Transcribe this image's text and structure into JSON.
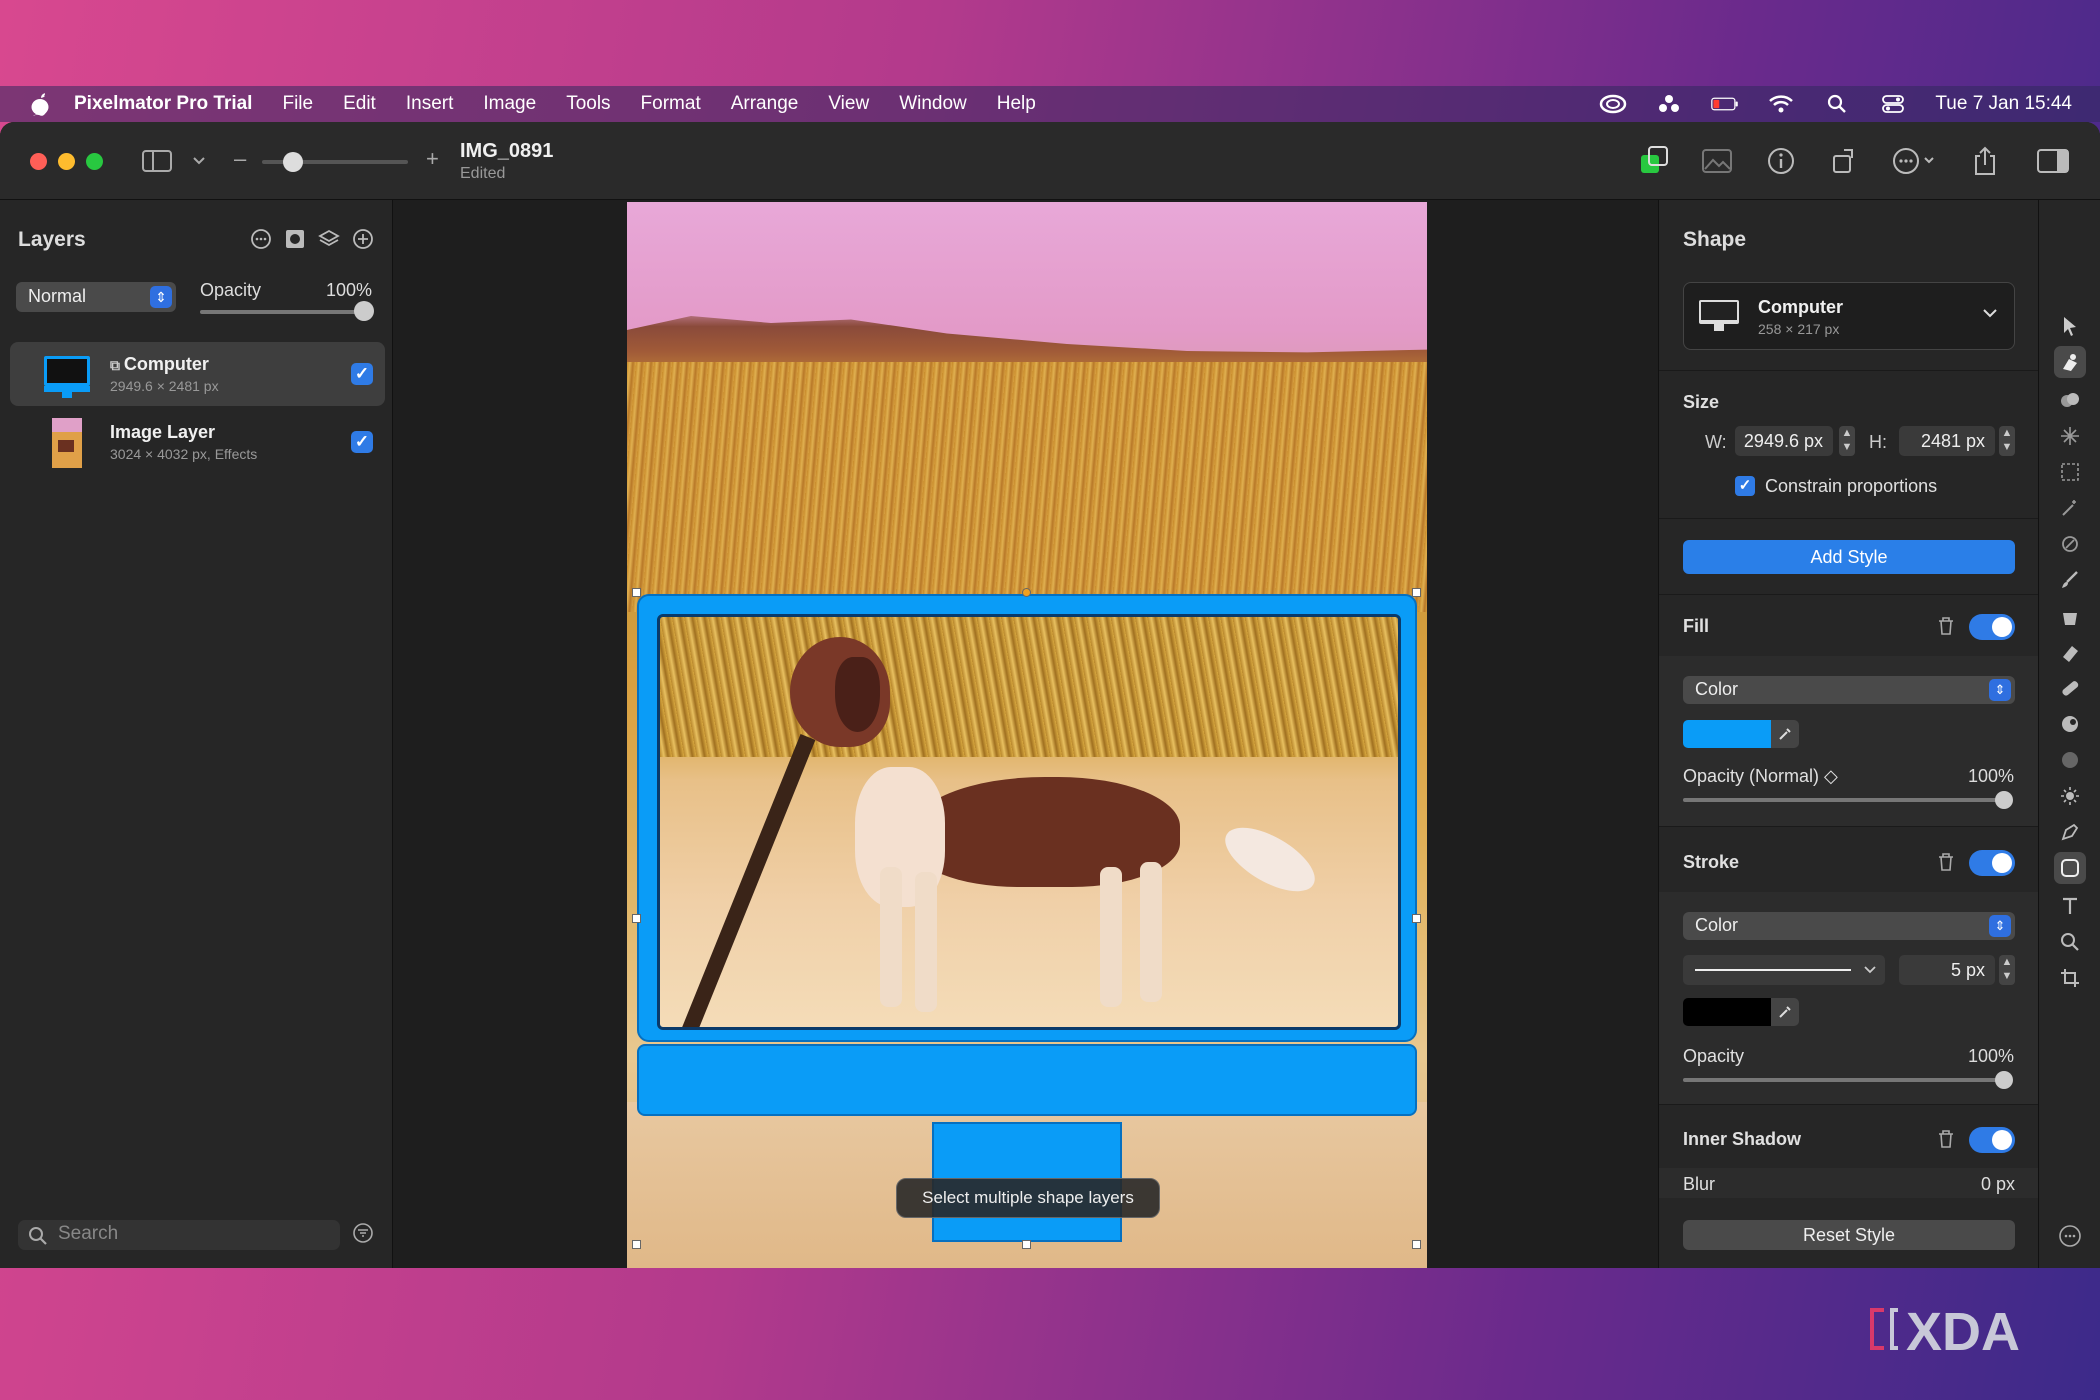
{
  "menubar": {
    "app_name": "Pixelmator Pro Trial",
    "items": [
      "File",
      "Edit",
      "Insert",
      "Image",
      "Tools",
      "Format",
      "Arrange",
      "View",
      "Window",
      "Help"
    ],
    "clock": "Tue 7 Jan  15:44"
  },
  "document": {
    "title": "IMG_0891",
    "subtitle": "Edited"
  },
  "layers_panel": {
    "title": "Layers",
    "blend_mode": "Normal",
    "opacity_label": "Opacity",
    "opacity_value": "100%",
    "opacity_fraction": 1.0,
    "layers": [
      {
        "name": "Computer",
        "meta": "2949.6 × 2481 px",
        "checked": true,
        "selected": true
      },
      {
        "name": "Image Layer",
        "meta": "3024 × 4032 px, Effects",
        "checked": true,
        "selected": false
      }
    ],
    "search_placeholder": "Search"
  },
  "canvas": {
    "tooltip": "Select multiple shape layers"
  },
  "shape_panel": {
    "title": "Shape",
    "preset_name": "Computer",
    "preset_meta": "258 × 217 px",
    "size_label": "Size",
    "w_label": "W:",
    "w_value": "2949.6 px",
    "h_label": "H:",
    "h_value": "2481 px",
    "constrain_label": "Constrain proportions",
    "add_style": "Add Style",
    "fill": {
      "label": "Fill",
      "type": "Color",
      "color": "#0a9cf7",
      "opacity_label": "Opacity (Normal) ◇",
      "opacity_value": "100%",
      "opacity_fraction": 1.0
    },
    "stroke": {
      "label": "Stroke",
      "type": "Color",
      "width": "5 px",
      "color": "#000000",
      "opacity_label": "Opacity",
      "opacity_value": "100%",
      "opacity_fraction": 1.0
    },
    "inner_shadow": {
      "label": "Inner Shadow",
      "blur_label": "Blur",
      "blur_value": "0 px"
    },
    "reset_style": "Reset Style"
  },
  "watermark": "XDA",
  "colors": {
    "accent": "#2f7be6",
    "shape_fill": "#0a9cf7"
  },
  "icons": [
    "apple-icon",
    "creative-cloud-icon",
    "dropbox-icon",
    "battery-icon",
    "wifi-icon",
    "search-icon",
    "control-center-icon",
    "sidebar-toggle-icon",
    "chevron-down-icon",
    "zoom-minus-icon",
    "zoom-plus-icon",
    "color-adjust-icon",
    "remove-background-icon",
    "info-icon",
    "rotate-icon",
    "more-icon",
    "share-icon",
    "right-sidebar-icon"
  ]
}
